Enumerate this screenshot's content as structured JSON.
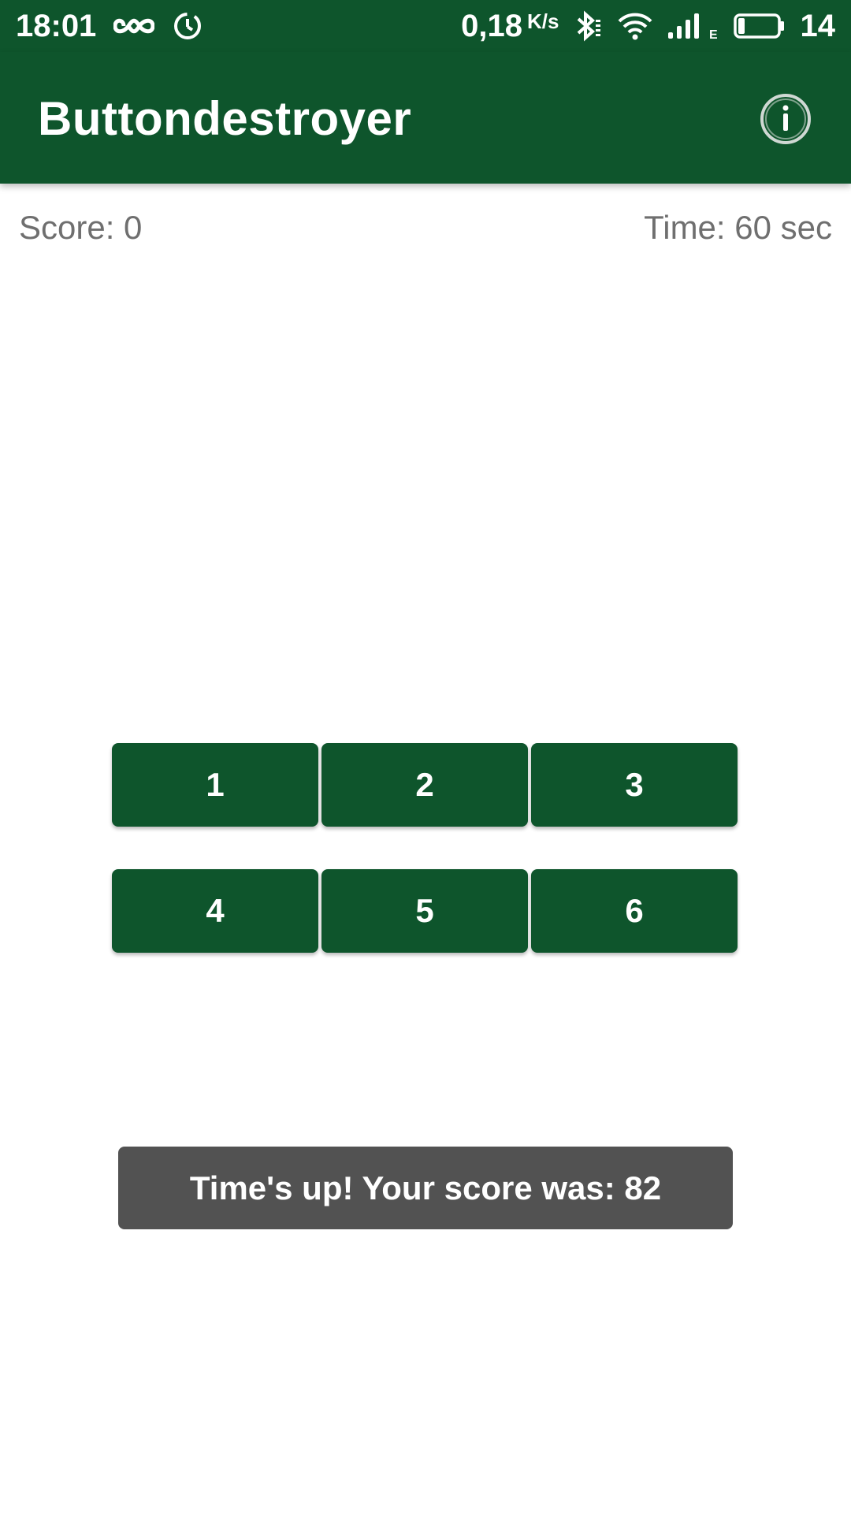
{
  "status_bar": {
    "time": "18:01",
    "speed_value": "0,18",
    "speed_unit": "K/s",
    "battery_level": "14",
    "network_type": "E",
    "icons": [
      "infinity-icon",
      "alarm-icon",
      "bluetooth-icon",
      "wifi-icon",
      "signal-icon",
      "battery-icon"
    ]
  },
  "app_bar": {
    "title": "Buttondestroyer",
    "info_icon": "info-icon"
  },
  "game": {
    "score_label": "Score: 0",
    "time_label": "Time: 60 sec",
    "buttons": [
      {
        "label": "1"
      },
      {
        "label": "2"
      },
      {
        "label": "3"
      },
      {
        "label": "4"
      },
      {
        "label": "5"
      },
      {
        "label": "6"
      }
    ]
  },
  "toast": {
    "message": "Time's up! Your score was: 82"
  },
  "colors": {
    "primary": "#0e552c",
    "toast_bg": "#525252",
    "muted_text": "#6f6f6f"
  }
}
